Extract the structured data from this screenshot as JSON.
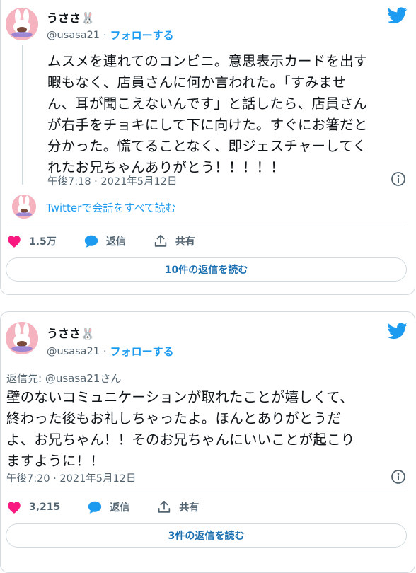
{
  "tweet1": {
    "author_name": "うささ🐰",
    "handle": "@usasa21",
    "separator": "·",
    "follow_label": "フォローする",
    "lines": [
      "ムスメを連れてのコンビニ。意思表示カードを出す",
      "暇もなく、店員さんに何か言われた。「すみませ",
      "ん、耳が聞こえないんです」と話したら、店員さん",
      "が右手をチョキにして下に向けた。すぐにお箸だと",
      "分かった。慌てることなく、即ジェスチャーしてく",
      "れたお兄ちゃんありがとう！！！！！"
    ],
    "timestamp": "午後7:18 · 2021年5月12日",
    "conversation_link": "Twitterで会話をすべて読む",
    "likes": "1.5万",
    "reply_label": "返信",
    "share_label": "共有",
    "read_replies_button": "10件の返信を読む"
  },
  "tweet2": {
    "author_name": "うささ🐰",
    "handle": "@usasa21",
    "separator": "·",
    "follow_label": "フォローする",
    "reply_to_prefix": "返信先: ",
    "reply_to_handle": "@usasa21さん",
    "lines": [
      "壁のないコミュニケーションが取れたことが嬉しくて、",
      "終わった後もお礼しちゃったよ。ほんとありがとうだ",
      "よ、お兄ちゃん！！そのお兄ちゃんにいいことが起こり",
      "ますように！！"
    ],
    "timestamp": "午後7:20 · 2021年5月12日",
    "likes": "3,215",
    "reply_label": "返信",
    "share_label": "共有",
    "read_replies_button": "3件の返信を読む"
  },
  "colors": {
    "accent": "#1d9bf0",
    "like": "#f91880",
    "text": "#0f1419",
    "muted": "#536471"
  },
  "icons": [
    "twitter-bird-icon",
    "info-icon",
    "heart-icon",
    "reply-bubble-icon",
    "share-icon"
  ]
}
